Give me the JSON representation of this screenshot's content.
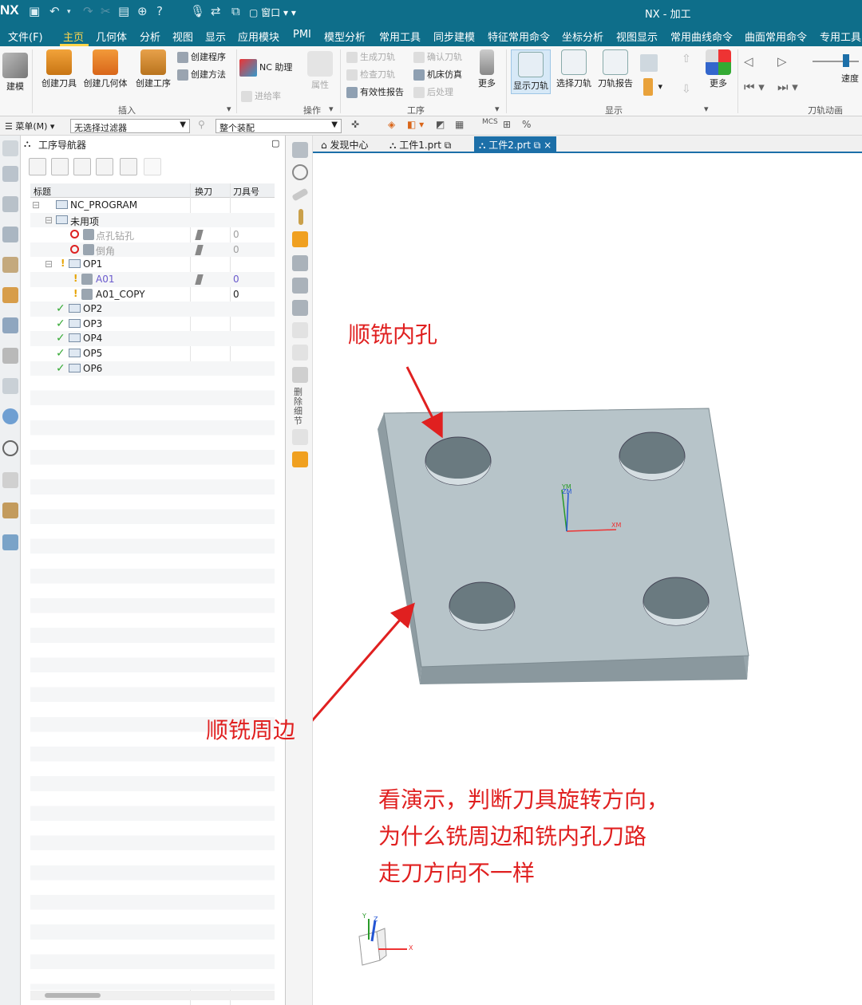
{
  "titlebar": {
    "logo": "NX",
    "window_menu": "窗口",
    "window_title": "NX - 加工"
  },
  "menubar": {
    "items": [
      "文件(F)",
      "主页",
      "几何体",
      "分析",
      "视图",
      "显示",
      "应用模块",
      "PMI",
      "模型分析",
      "常用工具",
      "同步建模",
      "特征常用命令",
      "坐标分析",
      "视图显示",
      "常用曲线命令",
      "曲面常用命令",
      "专用工具"
    ],
    "active": "主页"
  },
  "ribbon": {
    "jianmo": "建模",
    "create_tool": "创建刀具",
    "create_geometry": "创建几何体",
    "create_operation": "创建工序",
    "create_program": "创建程序",
    "create_method": "创建方法",
    "nc_assistant": "NC 助理",
    "attribute": "属性",
    "feedrate": "进给率",
    "generate_path": "生成刀轨",
    "verify_path": "确认刀轨",
    "check_tool": "检查刀轨",
    "machine_sim": "机床仿真",
    "validity_report": "有效性报告",
    "postprocess": "后处理",
    "more1": "更多",
    "show_path": "显示刀轨",
    "select_path": "选择刀轨",
    "path_report": "刀轨报告",
    "more2": "更多",
    "speed": "速度",
    "groups": {
      "insert": "插入",
      "operate": "操作",
      "procedure": "工序",
      "display": "显示",
      "animation": "刀轨动画"
    }
  },
  "filterbar": {
    "menu": "菜单(M)",
    "filter": "无选择过滤器",
    "assembly": "整个装配"
  },
  "navigator": {
    "title": "工序导航器",
    "columns": [
      "标题",
      "换刀",
      "刀具号"
    ],
    "rows": [
      {
        "label": "NC_PROGRAM",
        "col3": ""
      },
      {
        "label": "未用项",
        "col3": ""
      },
      {
        "label": "点孔钻孔",
        "col3": "0"
      },
      {
        "label": "倒角",
        "col3": "0"
      },
      {
        "label": "OP1",
        "col3": ""
      },
      {
        "label": "A01",
        "col3": "0"
      },
      {
        "label": "A01_COPY",
        "col3": "0"
      },
      {
        "label": "OP2",
        "col3": ""
      },
      {
        "label": "OP3",
        "col3": ""
      },
      {
        "label": "OP4",
        "col3": ""
      },
      {
        "label": "OP5",
        "col3": ""
      },
      {
        "label": "OP6",
        "col3": ""
      }
    ]
  },
  "side_toolbar_label": "删除细节",
  "tabs": [
    {
      "label": "发现中心"
    },
    {
      "label": "工件1.prt"
    },
    {
      "label": "工件2.prt",
      "active": true
    }
  ],
  "viewport": {
    "annotation_hole": "顺铣内孔",
    "annotation_edge": "顺铣周边",
    "question_lines": [
      "看演示，判断刀具旋转方向，",
      "为什么铣周边和铣内孔刀路",
      "走刀方向不一样"
    ],
    "wcs_x": "XM",
    "wcs_y": "YM",
    "wcs_z": "ZM",
    "triad_x": "X",
    "triad_y": "Y",
    "triad_z": "Z",
    "colors": {
      "annotation": "#e02020",
      "part_top": "#b6c3c8",
      "part_front": "#8c9ba1",
      "part_side": "#9aa8ae"
    }
  }
}
